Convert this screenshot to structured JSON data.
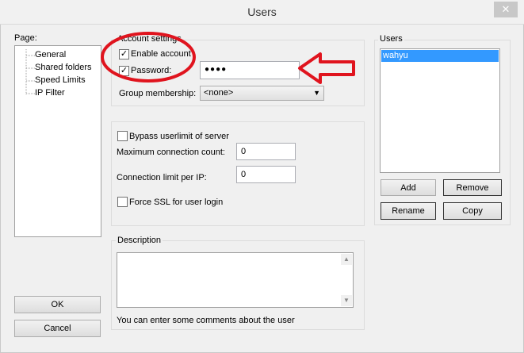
{
  "window": {
    "title": "Users",
    "close_label": "✕"
  },
  "page_panel": {
    "label": "Page:",
    "items": [
      "General",
      "Shared folders",
      "Speed Limits",
      "IP Filter"
    ],
    "ok_label": "OK",
    "cancel_label": "Cancel"
  },
  "account": {
    "group_label": "Account settings",
    "enable_label": "Enable account",
    "enable_checked": "✓",
    "password_label": "Password:",
    "password_checked": "✓",
    "password_value": "●●●●",
    "group_membership_label": "Group membership:",
    "group_membership_value": "<none>"
  },
  "limits": {
    "bypass_label": "Bypass userlimit of server",
    "max_conn_label": "Maximum connection count:",
    "max_conn_value": "0",
    "conn_per_ip_label": "Connection limit per IP:",
    "conn_per_ip_value": "0",
    "force_ssl_label": "Force SSL for user login"
  },
  "description": {
    "label": "Description",
    "hint": "You can enter some comments about the user"
  },
  "users": {
    "label": "Users",
    "items": [
      "wahyu"
    ],
    "add_label": "Add",
    "remove_label": "Remove",
    "rename_label": "Rename",
    "copy_label": "Copy"
  },
  "annotation": {
    "circle_color": "#e0141e",
    "arrow_color": "#e0141e"
  }
}
